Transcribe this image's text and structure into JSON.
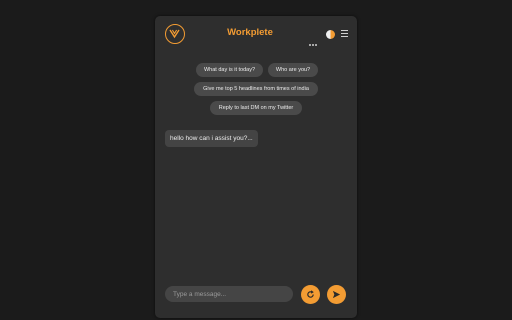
{
  "app": {
    "title": "Workplete"
  },
  "colors": {
    "accent": "#f39c33",
    "panel_bg": "#2e2e2e",
    "chip_bg": "#4a4a4a"
  },
  "header": {
    "logo_icon": "workplete-logo-icon",
    "more_icon": "more-dots-icon",
    "theme_icon": "theme-toggle-icon",
    "menu_icon": "hamburger-menu-icon"
  },
  "suggestions": [
    {
      "label": "What day is it today?"
    },
    {
      "label": "Who are you?"
    },
    {
      "label": "Give me top 5 headlines from times of india"
    },
    {
      "label": "Reply to last DM on my Twitter"
    }
  ],
  "messages": [
    {
      "role": "assistant",
      "text": "hello how can i assist you?..."
    }
  ],
  "composer": {
    "placeholder": "Type a message...",
    "value": "",
    "refresh_icon": "refresh-icon",
    "send_icon": "send-icon"
  }
}
